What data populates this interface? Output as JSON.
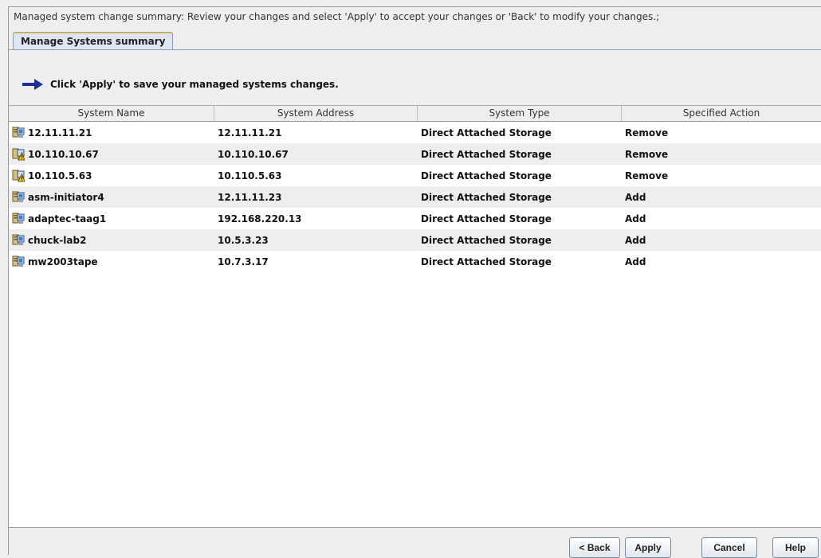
{
  "instruction": "Managed system change summary: Review your changes and select 'Apply' to accept your changes or 'Back' to modify your changes.;",
  "tab": {
    "label": "Manage Systems summary"
  },
  "note": {
    "text": "Click 'Apply' to save your managed systems changes."
  },
  "table": {
    "columns": [
      "System Name",
      "System Address",
      "System Type",
      "Specified Action"
    ],
    "rows": [
      {
        "name": "12.11.11.21",
        "address": "12.11.11.21",
        "type": "Direct Attached Storage",
        "action": "Remove",
        "icon": "computer-icon"
      },
      {
        "name": "10.110.10.67",
        "address": "10.110.10.67",
        "type": "Direct Attached Storage",
        "action": "Remove",
        "icon": "warning-computer-icon"
      },
      {
        "name": "10.110.5.63",
        "address": "10.110.5.63",
        "type": "Direct Attached Storage",
        "action": "Remove",
        "icon": "warning-computer-icon"
      },
      {
        "name": "asm-initiator4",
        "address": "12.11.11.23",
        "type": "Direct Attached Storage",
        "action": "Add",
        "icon": "computer-icon"
      },
      {
        "name": "adaptec-taag1",
        "address": "192.168.220.13",
        "type": "Direct Attached Storage",
        "action": "Add",
        "icon": "computer-icon"
      },
      {
        "name": "chuck-lab2",
        "address": "10.5.3.23",
        "type": "Direct Attached Storage",
        "action": "Add",
        "icon": "computer-icon"
      },
      {
        "name": "mw2003tape",
        "address": "10.7.3.17",
        "type": "Direct Attached Storage",
        "action": "Add",
        "icon": "computer-icon"
      }
    ]
  },
  "buttons": {
    "back": "< Back",
    "apply": "Apply",
    "cancel": "Cancel",
    "help": "Help"
  },
  "colors": {
    "arrow": "#1a2fa0",
    "tab_bg": "#dde6f1",
    "row_alt": "#eeeeee"
  }
}
